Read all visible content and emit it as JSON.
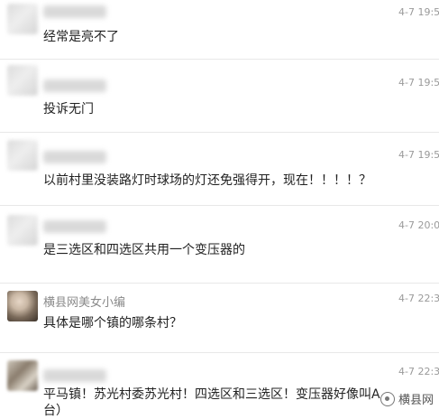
{
  "comments": [
    {
      "time": "4-7 19:52",
      "text": "经常是亮不了"
    },
    {
      "time": "4-7 19:52",
      "text": "投诉无门"
    },
    {
      "time": "4-7 19:53",
      "text": "以前村里没装路灯时球场的灯还免强得开，现在！！！！？"
    },
    {
      "time": "4-7 20:00",
      "text": "是三选区和四选区共用一个变压器的"
    },
    {
      "name": "横县网美女小编",
      "time": "4-7 22:30",
      "text": "具体是哪个镇的哪条村？"
    },
    {
      "time": "4-7 22:31",
      "text": "平马镇！苏光村委苏光村！四选区和三选区！变压器好像叫A台）"
    }
  ],
  "watermark": {
    "text": "横县网",
    "icon": "wechat-logo-icon"
  }
}
